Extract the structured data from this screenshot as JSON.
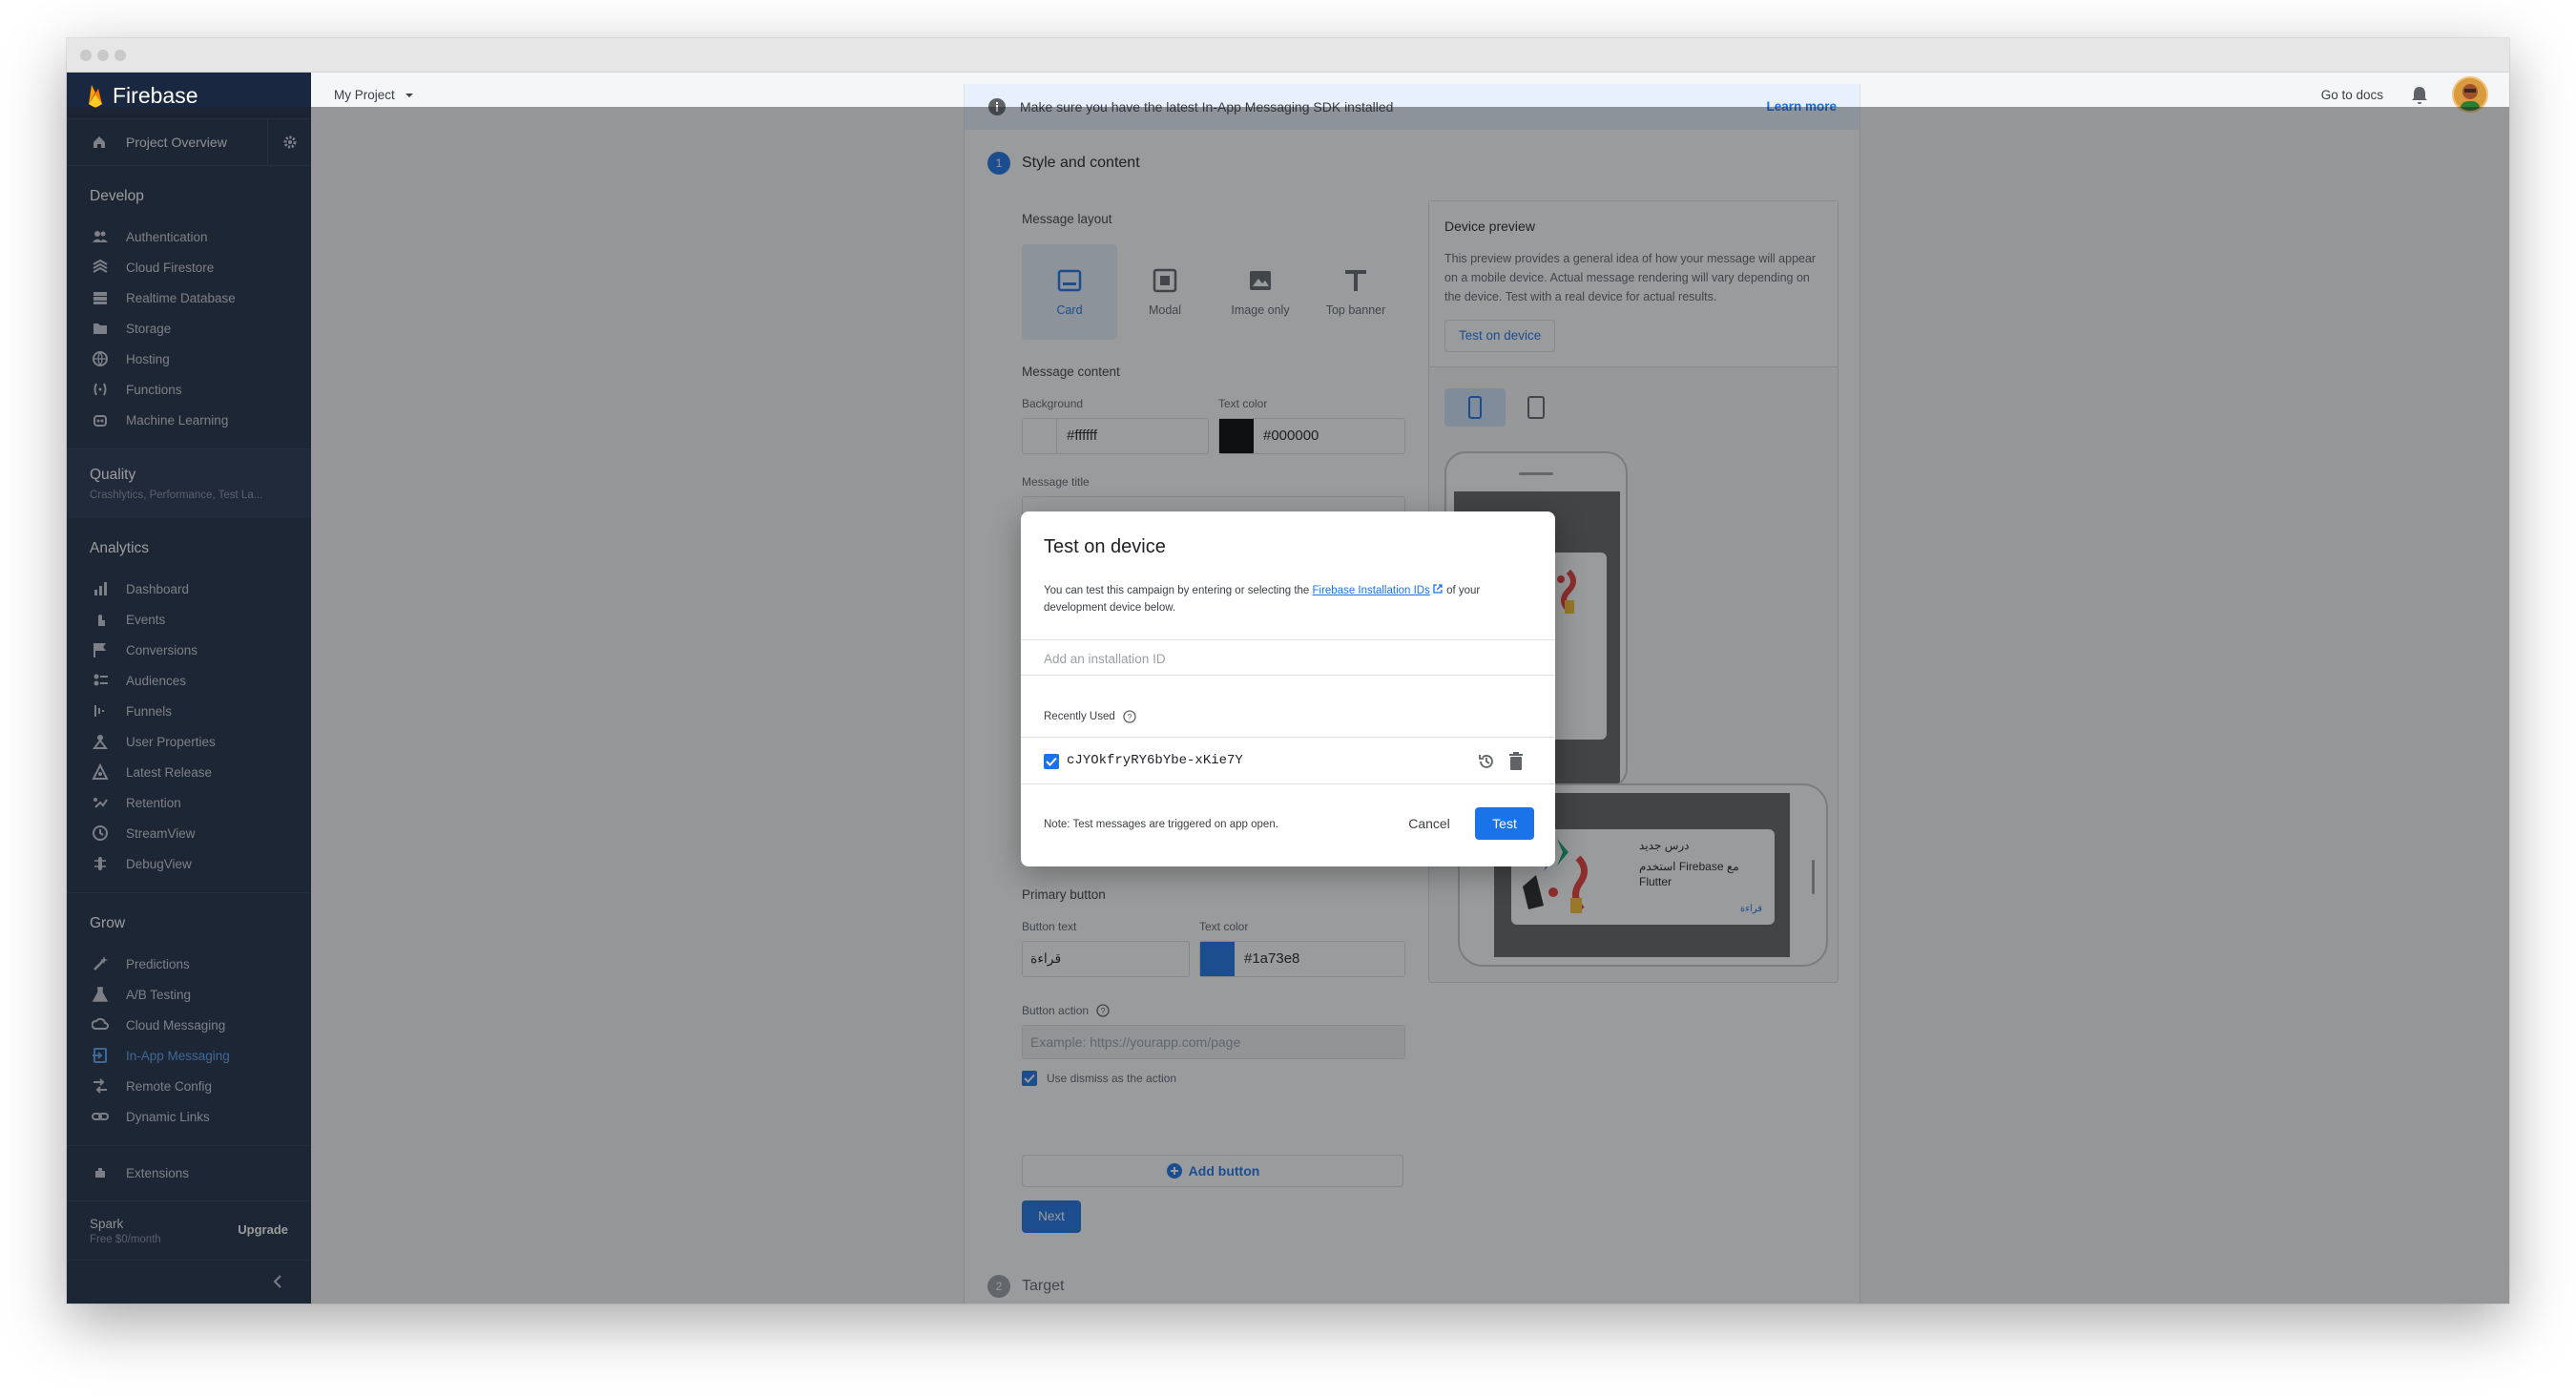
{
  "app": {
    "brand": "Firebase",
    "project": "My Project"
  },
  "sidebar": {
    "overview": "Project Overview",
    "develop": {
      "title": "Develop",
      "items": [
        {
          "label": "Authentication",
          "icon": "people-icon"
        },
        {
          "label": "Cloud Firestore",
          "icon": "firestore-icon"
        },
        {
          "label": "Realtime Database",
          "icon": "database-icon"
        },
        {
          "label": "Storage",
          "icon": "storage-icon"
        },
        {
          "label": "Hosting",
          "icon": "globe-icon"
        },
        {
          "label": "Functions",
          "icon": "functions-icon"
        },
        {
          "label": "Machine Learning",
          "icon": "robot-icon"
        }
      ]
    },
    "quality": {
      "title": "Quality",
      "subtitle": "Crashlytics, Performance, Test La..."
    },
    "analytics": {
      "title": "Analytics",
      "items": [
        {
          "label": "Dashboard",
          "icon": "bar-chart-icon"
        },
        {
          "label": "Events",
          "icon": "touch-icon"
        },
        {
          "label": "Conversions",
          "icon": "flag-icon"
        },
        {
          "label": "Audiences",
          "icon": "audience-icon"
        },
        {
          "label": "Funnels",
          "icon": "funnel-icon"
        },
        {
          "label": "User Properties",
          "icon": "user-properties-icon"
        },
        {
          "label": "Latest Release",
          "icon": "release-icon"
        },
        {
          "label": "Retention",
          "icon": "retention-icon"
        },
        {
          "label": "StreamView",
          "icon": "clock-icon"
        },
        {
          "label": "DebugView",
          "icon": "debug-icon"
        }
      ]
    },
    "grow": {
      "title": "Grow",
      "items": [
        {
          "label": "Predictions",
          "icon": "wand-icon"
        },
        {
          "label": "A/B Testing",
          "icon": "flask-icon"
        },
        {
          "label": "Cloud Messaging",
          "icon": "cloud-messaging-icon"
        },
        {
          "label": "In-App Messaging",
          "icon": "in-app-messaging-icon"
        },
        {
          "label": "Remote Config",
          "icon": "remote-config-icon"
        },
        {
          "label": "Dynamic Links",
          "icon": "link-icon"
        }
      ]
    },
    "extensions": "Extensions",
    "plan": {
      "name": "Spark",
      "sub": "Free $0/month",
      "upgrade": "Upgrade"
    }
  },
  "topbar": {
    "go_to_docs": "Go to docs"
  },
  "banner": {
    "text": "Make sure you have the latest In-App Messaging SDK installed",
    "link": "Learn more"
  },
  "step1": {
    "num": "1",
    "title": "Style and content"
  },
  "step2": {
    "num": "2",
    "title": "Target"
  },
  "layout": {
    "label": "Message layout",
    "options": [
      "Card",
      "Modal",
      "Image only",
      "Top banner"
    ]
  },
  "content": {
    "label": "Message content",
    "background_label": "Background",
    "background_value": "#ffffff",
    "text_color_label": "Text color",
    "text_color_value": "#000000",
    "message_title_label": "Message title"
  },
  "primary_button": {
    "label": "Primary button",
    "text_label": "Button text",
    "text_value": "قراءة",
    "color_label": "Text color",
    "color_value": "#1a73e8",
    "action_label": "Button action",
    "action_placeholder": "Example: https://yourapp.com/page",
    "dismiss_label": "Use dismiss as the action",
    "add_button": "Add button",
    "next": "Next"
  },
  "device_preview": {
    "title": "Device preview",
    "description": "This preview provides a general idea of how your message will appear on a mobile device. Actual message rendering will vary depending on the device. Test with a real device for actual results.",
    "test_button": "Test on device",
    "card_title": "درس جديد",
    "card_body_1": "استخدم Firebase مع",
    "card_body_2": "Flutter",
    "card_action": "قراءة"
  },
  "dialog": {
    "title": "Test on device",
    "desc_before": "You can test this campaign by entering or selecting the ",
    "desc_link": "Firebase Installation IDs",
    "desc_after": " of your development device below.",
    "input_placeholder": "Add an installation ID",
    "recently_used": "Recently Used",
    "installation_id": "cJYOkfryRY6bYbe-xKie7Y",
    "note": "Note: Test messages are triggered on app open.",
    "cancel": "Cancel",
    "test": "Test"
  },
  "colors": {
    "accent": "#1a73e8",
    "sidebar": "#1d2a43",
    "firebase_yellow": "#ffca28",
    "firebase_orange": "#f57c00"
  }
}
